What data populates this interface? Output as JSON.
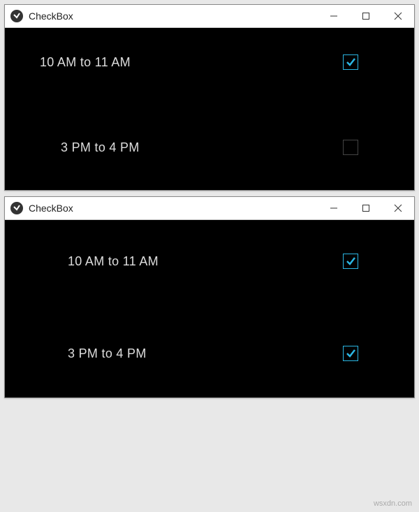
{
  "windows": [
    {
      "title": "CheckBox",
      "rows": [
        {
          "label": "10 AM to 11 AM",
          "checked": true
        },
        {
          "label": "3 PM to 4 PM",
          "checked": false
        }
      ]
    },
    {
      "title": "CheckBox",
      "rows": [
        {
          "label": "10 AM to 11 AM",
          "checked": true
        },
        {
          "label": "3 PM to 4 PM",
          "checked": true
        }
      ]
    }
  ],
  "watermark": "wsxdn.com"
}
